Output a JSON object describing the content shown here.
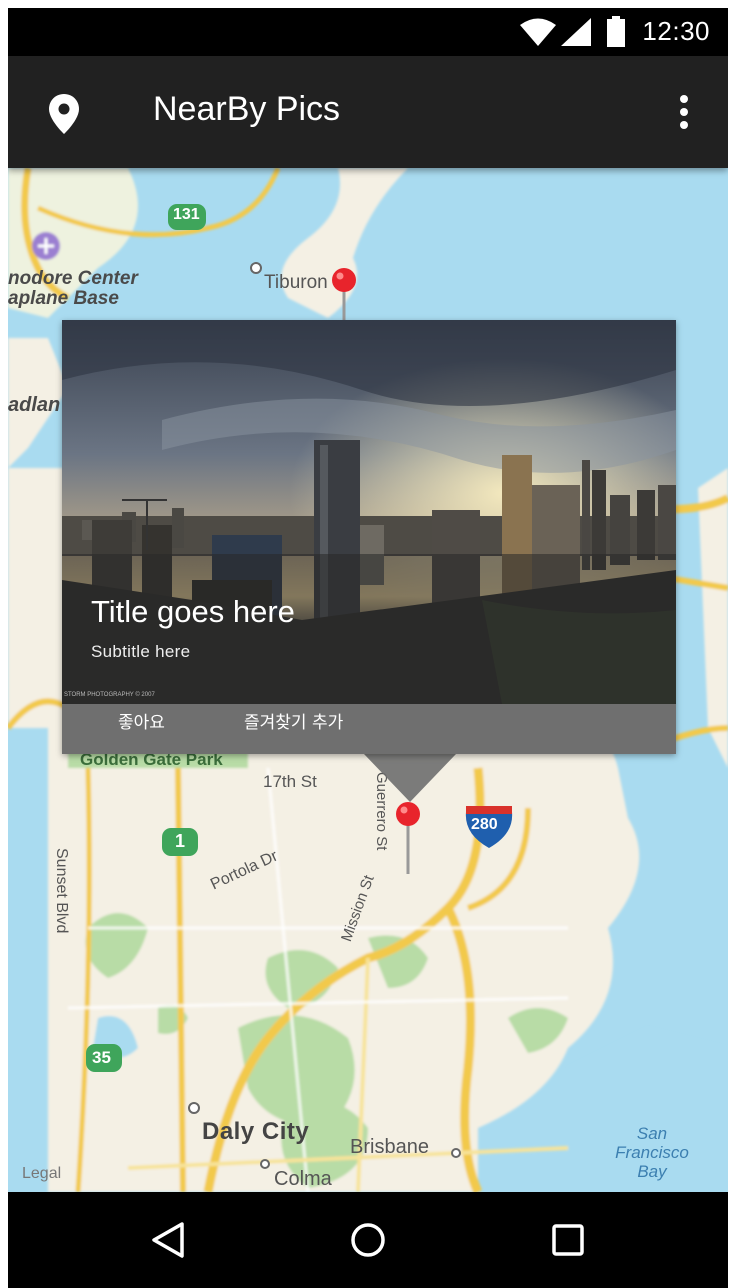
{
  "status_bar": {
    "time": "12:30"
  },
  "app_bar": {
    "title": "NearBy Pics"
  },
  "map": {
    "labels": {
      "tiburon": "Tiburon",
      "center_line1": "nodore Center",
      "center_line2": "aplane Base",
      "alameda": "adlan",
      "golden_gate_park": "Golden Gate Park",
      "seventeenth_st": "17th St",
      "sunset_blvd": "Sunset Blvd",
      "portola_dr": "Portola Dr",
      "guerrero_st": "Guerrero St",
      "mission_st": "Mission St",
      "daly_city": "Daly City",
      "brisbane": "Brisbane",
      "colma": "Colma",
      "sf_bay_line1": "San",
      "sf_bay_line2": "Francisco",
      "sf_bay_line3": "Bay",
      "legal": "Legal"
    },
    "shields": {
      "route_131": "131",
      "route_1": "1",
      "route_35": "35",
      "interstate_280": "280"
    }
  },
  "card": {
    "title": "Title goes here",
    "subtitle": "Subtitle here",
    "photo_credit": "STORM PHOTOGRAPHY © 2007",
    "actions": {
      "like": "좋아요",
      "favorite": "즐겨찾기 추가"
    }
  },
  "colors": {
    "app_bar": "#212121",
    "status_bar": "#000000",
    "card_actions": "#6f6f6f",
    "pin": "#e8242c",
    "water": "#a9dbf0",
    "land": "#f4f0e4"
  },
  "icons": {
    "status": [
      "wifi-icon",
      "signal-icon",
      "battery-icon"
    ],
    "app_bar": [
      "location-pin-icon",
      "overflow-menu-icon"
    ],
    "nav": [
      "back-icon",
      "home-icon",
      "recents-icon"
    ]
  }
}
